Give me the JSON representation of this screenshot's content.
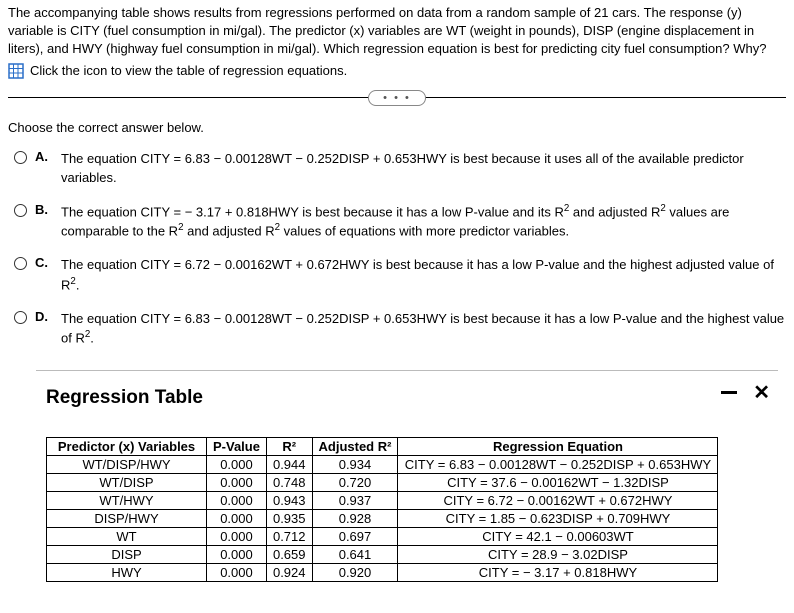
{
  "intro": "The accompanying table shows results from regressions performed on data from a random sample of 21 cars. The response (y) variable is CITY (fuel consumption in mi/gal). The predictor (x) variables are WT (weight in pounds), DISP (engine displacement in liters), and HWY (highway fuel consumption in mi/gal). Which regression equation is best for predicting city fuel consumption? Why?",
  "link_text": "Click the icon to view the table of regression equations.",
  "prompt": "Choose the correct answer below.",
  "options": [
    {
      "letter": "A.",
      "text_html": "The equation CITY = 6.83 − 0.00128WT − 0.252DISP + 0.653HWY is best because it uses all of the available predictor variables."
    },
    {
      "letter": "B.",
      "text_html": "The equation CITY = − 3.17 + 0.818HWY is best because it has a low P-value and its R<sup>2</sup> and adjusted R<sup>2</sup> values are comparable to the R<sup>2</sup> and adjusted R<sup>2</sup> values of equations with more predictor variables."
    },
    {
      "letter": "C.",
      "text_html": "The equation CITY = 6.72 − 0.00162WT + 0.672HWY is best because it has a low P-value and the highest adjusted value of R<sup>2</sup>."
    },
    {
      "letter": "D.",
      "text_html": "The equation CITY = 6.83 − 0.00128WT − 0.252DISP + 0.653HWY is best because it has a low P-value and the highest value of R<sup>2</sup>."
    }
  ],
  "modal_title": "Regression Table",
  "table": {
    "headers": [
      "Predictor (x) Variables",
      "P-Value",
      "R²",
      "Adjusted R²",
      "Regression Equation"
    ],
    "rows": [
      [
        "WT/DISP/HWY",
        "0.000",
        "0.944",
        "0.934",
        "CITY = 6.83 − 0.00128WT − 0.252DISP + 0.653HWY"
      ],
      [
        "WT/DISP",
        "0.000",
        "0.748",
        "0.720",
        "CITY = 37.6 − 0.00162WT − 1.32DISP"
      ],
      [
        "WT/HWY",
        "0.000",
        "0.943",
        "0.937",
        "CITY = 6.72 − 0.00162WT + 0.672HWY"
      ],
      [
        "DISP/HWY",
        "0.000",
        "0.935",
        "0.928",
        "CITY = 1.85 − 0.623DISP + 0.709HWY"
      ],
      [
        "WT",
        "0.000",
        "0.712",
        "0.697",
        "CITY = 42.1 − 0.00603WT"
      ],
      [
        "DISP",
        "0.000",
        "0.659",
        "0.641",
        "CITY = 28.9 − 3.02DISP"
      ],
      [
        "HWY",
        "0.000",
        "0.924",
        "0.920",
        "CITY = − 3.17 + 0.818HWY"
      ]
    ]
  }
}
